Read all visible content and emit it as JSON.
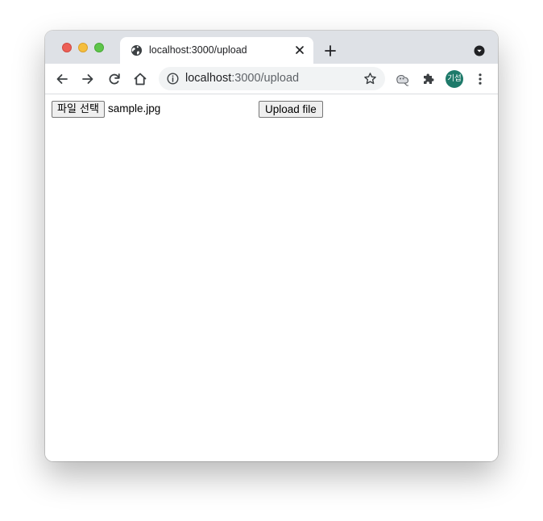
{
  "browser": {
    "tab": {
      "title": "localhost:3000/upload"
    },
    "address_bar": {
      "host": "localhost",
      "path": ":3000/upload"
    },
    "profile": {
      "initials": "기섭",
      "color": "#1e7a6a"
    }
  },
  "page": {
    "file_input": {
      "button_label": "파일 선택",
      "selected_file": "sample.jpg"
    },
    "upload_button_label": "Upload file"
  },
  "colors": {
    "tabstrip": "#dee1e6",
    "omnibox": "#f1f3f4",
    "traffic_close": "#ec5f56",
    "traffic_minimize": "#f5be3d",
    "traffic_maximize": "#5ec54a"
  }
}
